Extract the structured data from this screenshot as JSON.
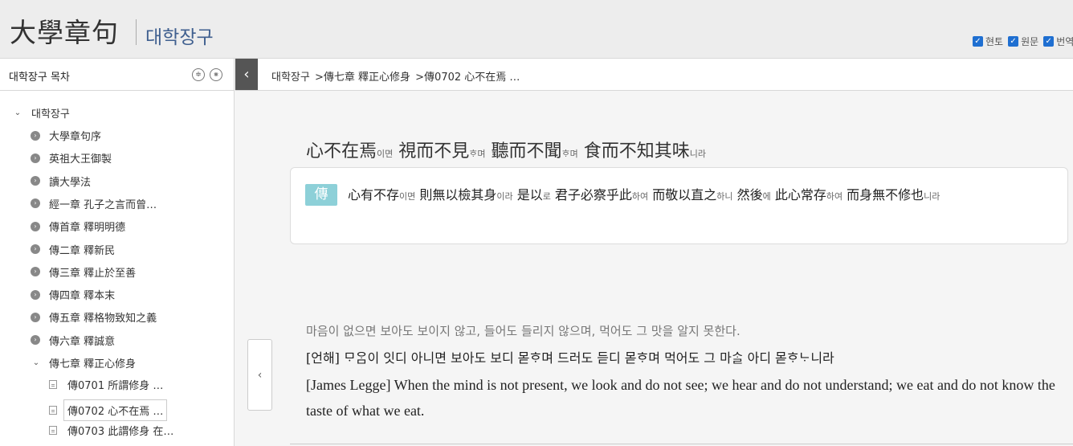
{
  "header": {
    "title_hanja": "大學章句",
    "title_korean": "대학장구",
    "options": [
      {
        "label": "현토",
        "checked": true
      },
      {
        "label": "원문",
        "checked": true
      },
      {
        "label": "번역",
        "checked": true
      }
    ]
  },
  "sidebar": {
    "title": "대학장구 목차",
    "btn_expand": "≑",
    "btn_collapse": "⨳",
    "root": "대학장구",
    "items": [
      "大學章句序",
      "英祖大王御製",
      "讀大學法",
      "經一章 孔子之言而曾…",
      "傳首章 釋明明德",
      "傳二章 釋新民",
      "傳三章 釋止於至善",
      "傳四章 釋本末",
      "傳五章 釋格物致知之義",
      "傳六章 釋誠意",
      "傳七章 釋正心修身"
    ],
    "subitems": [
      "傳0701 所謂修身 …",
      "傳0702 心不在焉 …",
      "傳0703 此謂修身 在…"
    ]
  },
  "breadcrumb": {
    "items": [
      "대학장구",
      ">傳七章 釋正心修身",
      ">傳0702 心不在焉 …"
    ]
  },
  "main": {
    "verse": [
      {
        "t": "心不在焉",
        "s": "이면"
      },
      {
        "t": " 視而不見",
        "s": "ᄒᆞ며"
      },
      {
        "t": " 聽而不聞",
        "s": "ᄒᆞ며"
      },
      {
        "t": " 食而不知其味",
        "s": "니라"
      }
    ],
    "commentary_badge": "傳",
    "commentary": [
      {
        "t": "心有不存",
        "s": "이면"
      },
      {
        "t": " 則無以檢其身",
        "s": "이라"
      },
      {
        "t": " 是以",
        "s": "로"
      },
      {
        "t": " 君子必察乎此",
        "s": "하여"
      },
      {
        "t": " 而敬以直之",
        "s": "하니"
      },
      {
        "t": " 然後",
        "s": "에"
      },
      {
        "t": " 此心常存",
        "s": "하여"
      },
      {
        "t": " 而身無不修也",
        "s": "니라"
      }
    ],
    "translation_korean": "마음이 없으면 보아도 보이지 않고, 들어도 들리지 않으며, 먹어도 그 맛을 알지 못한다.",
    "translation_eonhae": "[언해] ᄆᆞᄋᆞᆷ이 잇디 아니면 보아도 보디 몯ᄒᆞ며 드러도 듣디 몯ᄒᆞ며 먹어도 그 마ᄉᆞᆯ 아디 몯ᄒᆞᄂᆞ니라",
    "translation_english": "[James Legge] When the mind is not present, we look and do not see; we hear and do not understand; we eat and do not know the taste of what we eat.",
    "side_tab": "‹"
  }
}
